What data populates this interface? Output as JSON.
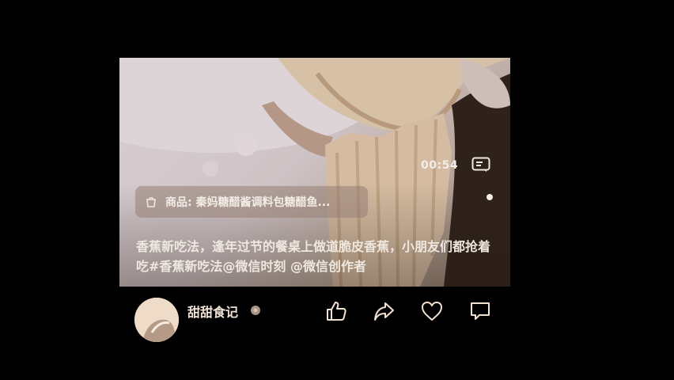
{
  "video": {
    "duration": "00:54",
    "product_label": "商品: 秦妈糖醋酱调料包糖醋鱼...",
    "caption": "香蕉新吃法，逢年过节的餐桌上做道脆皮香蕉，小朋友们都抢着吃#香蕉新吃法@微信时刻 @微信创作者"
  },
  "author": {
    "name": "甜甜食记"
  },
  "actions": [
    {
      "icon": "thumbs-up-icon"
    },
    {
      "icon": "share-icon"
    },
    {
      "icon": "heart-icon"
    },
    {
      "icon": "comment-icon"
    }
  ],
  "colors": {
    "background": "#000000",
    "icon": "#f3e2cf",
    "text": "#efe8e0"
  }
}
